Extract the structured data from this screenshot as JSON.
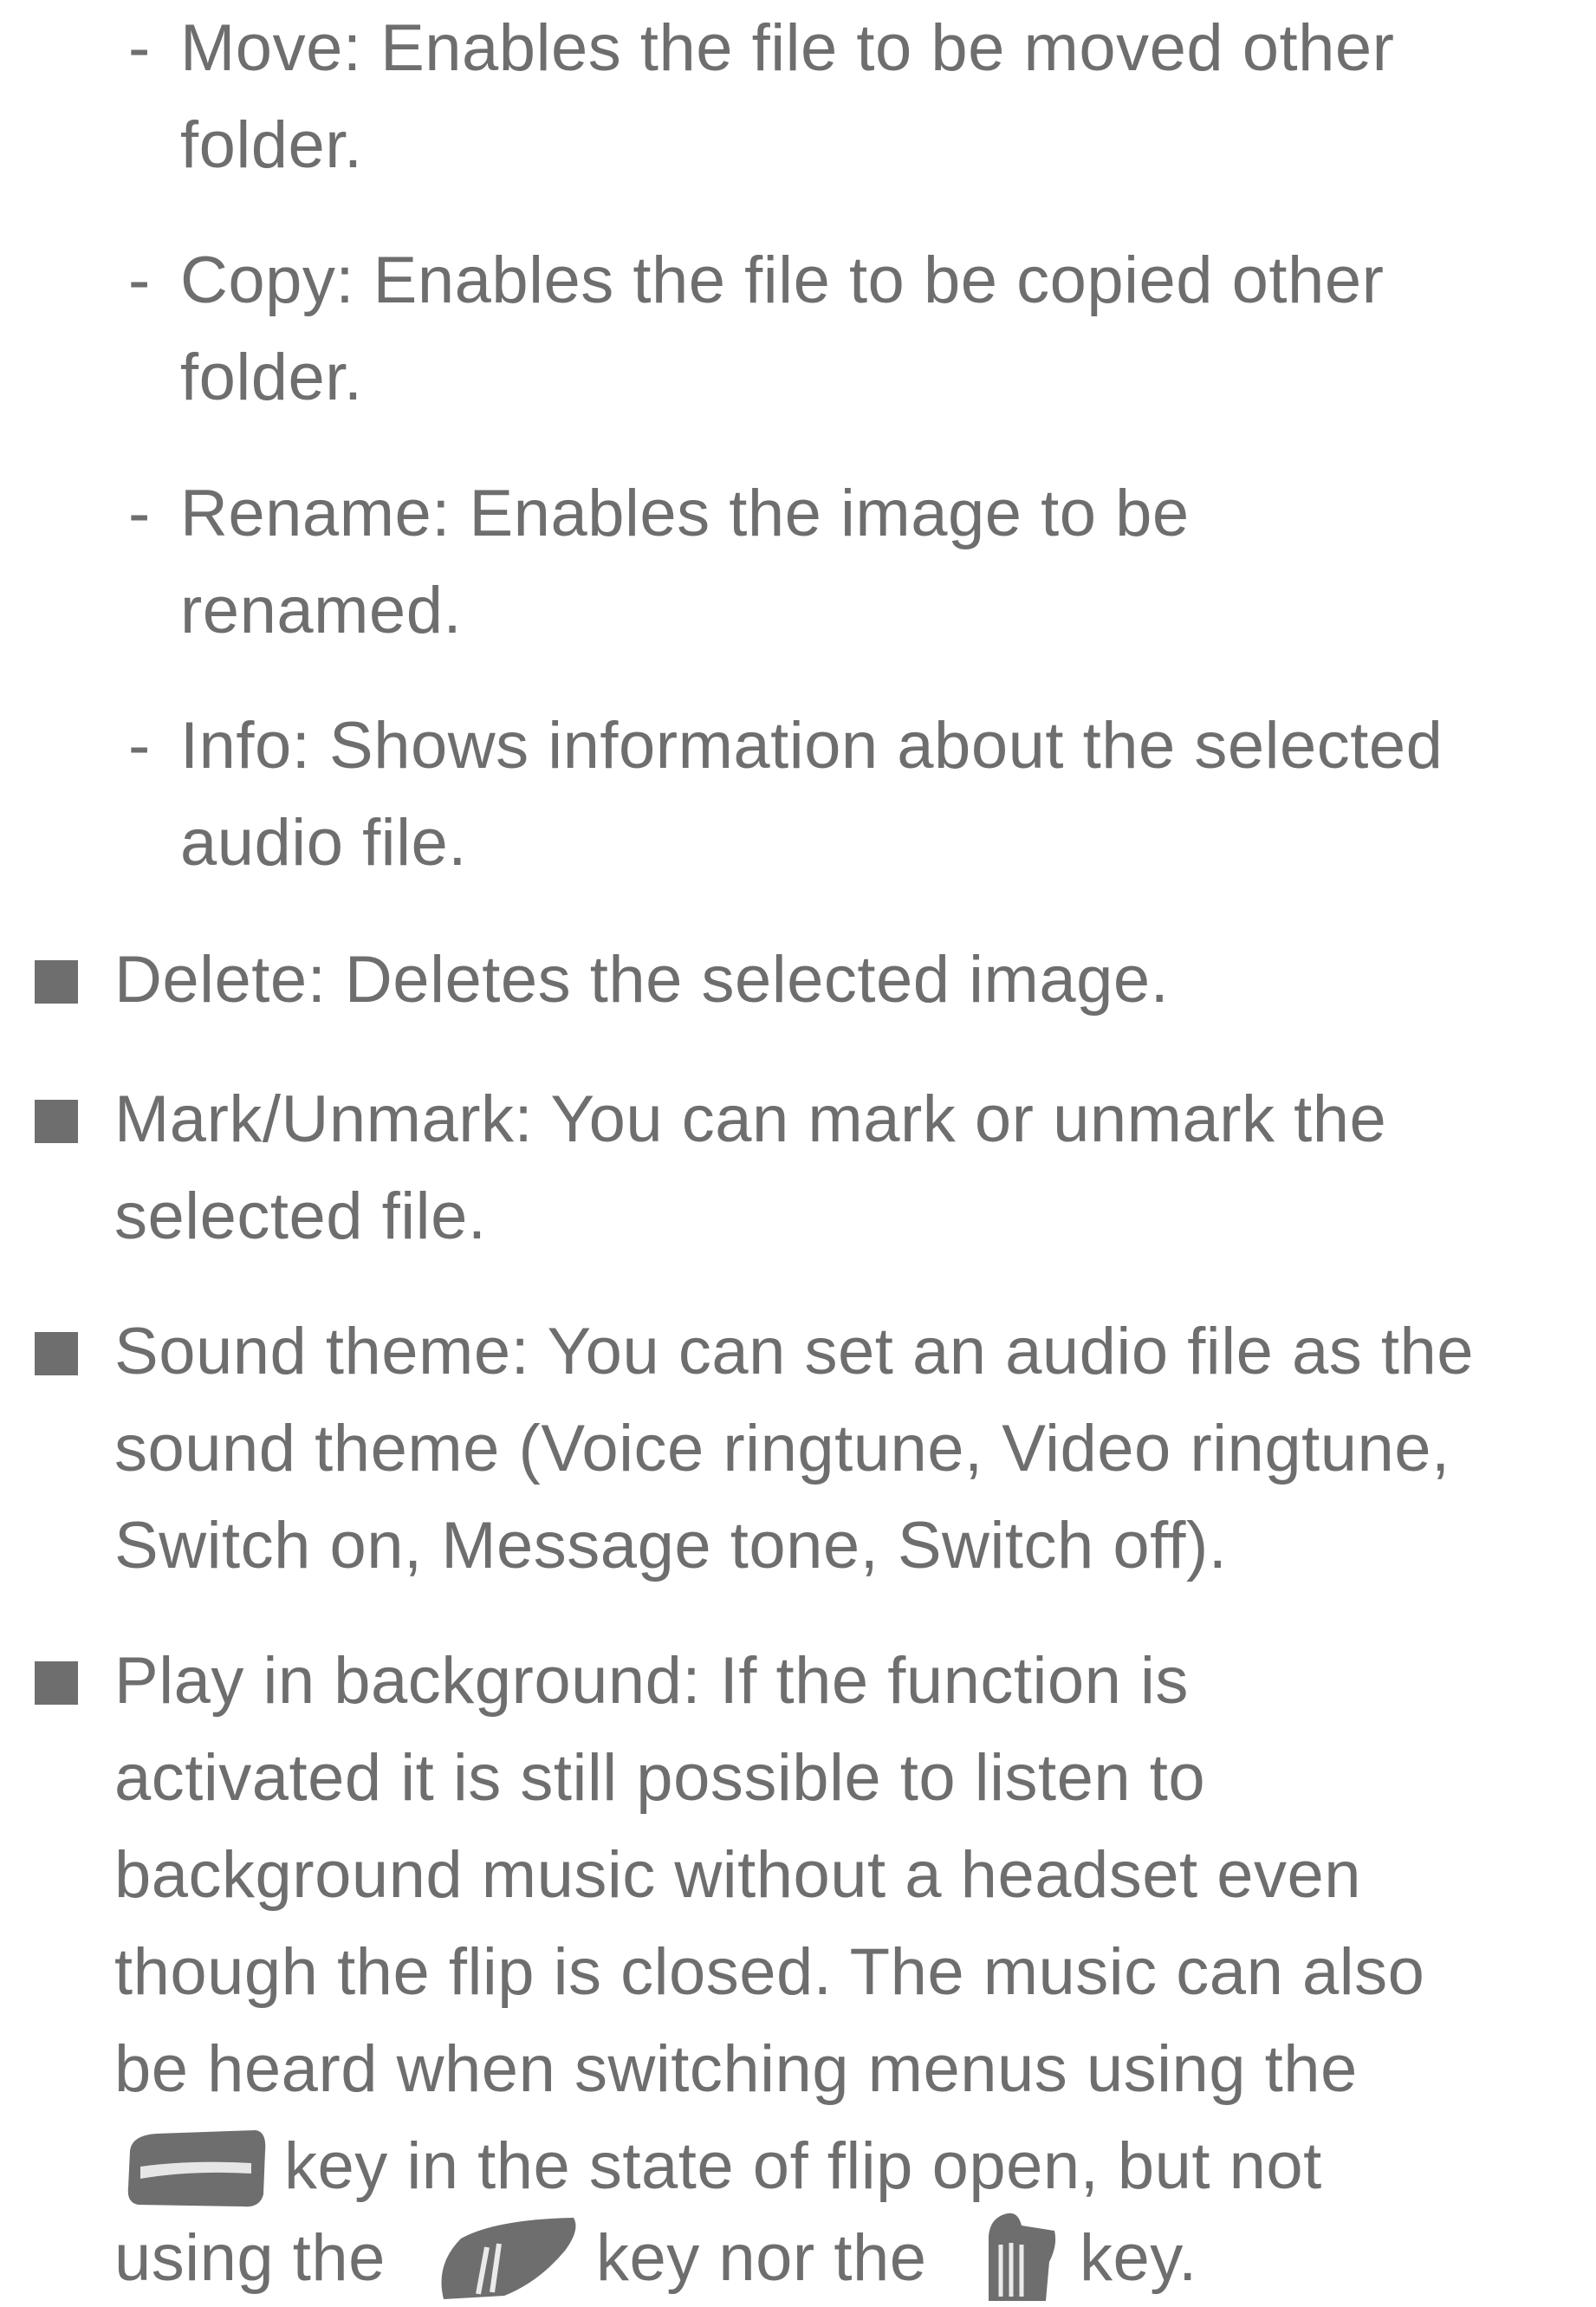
{
  "sub_items": [
    {
      "dash": "-",
      "lines": [
        "Move: Enables the file to be moved other",
        "folder."
      ]
    },
    {
      "dash": "-",
      "lines": [
        "Copy: Enables the file to be copied other",
        "folder."
      ]
    },
    {
      "dash": "-",
      "lines": [
        "Rename: Enables the image to be",
        "renamed."
      ]
    },
    {
      "dash": "-",
      "lines": [
        "Info: Shows information about the selected",
        "audio file."
      ]
    }
  ],
  "items": [
    {
      "lines": [
        "Delete: Deletes the selected image."
      ]
    },
    {
      "lines": [
        "Mark/Unmark: You can mark or unmark the",
        "selected file."
      ]
    },
    {
      "lines": [
        "Sound theme: You can set an audio file as the",
        "sound theme (Voice ringtune, Video ringtune,",
        "Switch on, Message tone, Switch off)."
      ]
    },
    {
      "lines": [
        "Play in background: If the function is",
        "activated it is still possible to listen to",
        "background music without a headset even",
        "though the flip is closed. The music can also",
        "be heard when switching menus using the"
      ]
    }
  ],
  "last_lines": {
    "line1_text": "key in the state of flip open, but not",
    "line2_part1": "using the",
    "line2_part2": "key nor the",
    "line2_part3": "key."
  },
  "icons": {
    "key1": "end-key-icon",
    "key2": "side-key-icon",
    "key3": "camera-key-icon"
  },
  "colors": {
    "text": "#6e6e6e",
    "background": "#ffffff"
  }
}
